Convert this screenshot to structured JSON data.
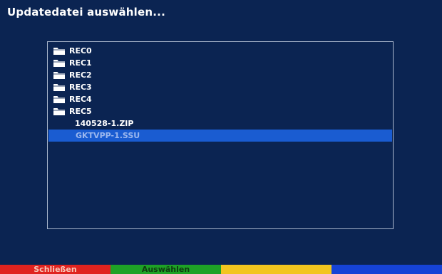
{
  "title": "Updatedatei auswählen...",
  "files": [
    {
      "type": "folder",
      "label": "REC0",
      "icon": "folder-icon"
    },
    {
      "type": "folder",
      "label": "REC1",
      "icon": "folder-icon"
    },
    {
      "type": "folder",
      "label": "REC2",
      "icon": "folder-icon"
    },
    {
      "type": "folder",
      "label": "REC3",
      "icon": "folder-icon"
    },
    {
      "type": "folder",
      "label": "REC4",
      "icon": "folder-icon"
    },
    {
      "type": "folder",
      "label": "REC5",
      "icon": "folder-icon"
    },
    {
      "type": "file",
      "label": "140528-1.ZIP"
    },
    {
      "type": "file",
      "label": "GKTVPP-1.SSU",
      "selected": true
    }
  ],
  "buttons": {
    "red": "Schließen",
    "green": "Auswählen",
    "yellow": "",
    "blue": ""
  },
  "colors": {
    "background": "#0b2452",
    "selection": "#1a5cd1",
    "red": "#e0231f",
    "green": "#1ea226",
    "yellow": "#f2c51f",
    "blue": "#1643d6"
  }
}
